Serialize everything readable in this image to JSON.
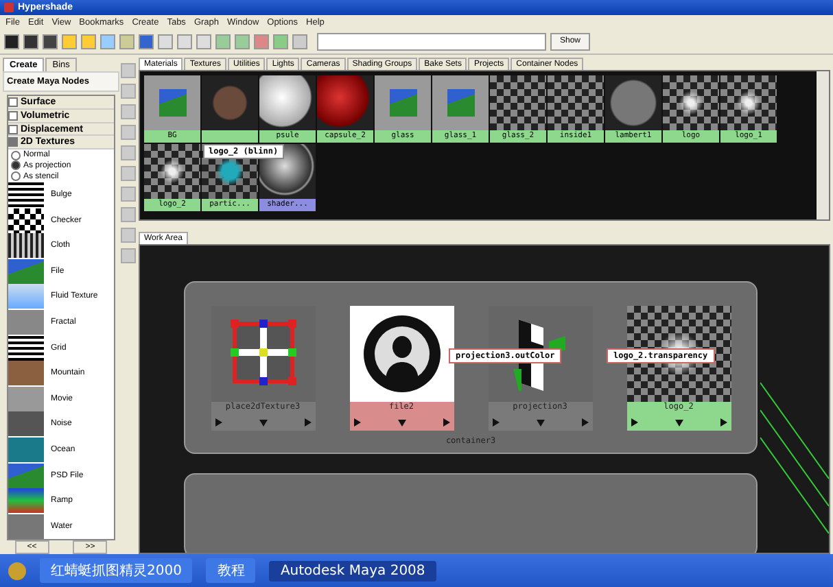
{
  "window": {
    "title": "Hypershade"
  },
  "menu": [
    "File",
    "Edit",
    "View",
    "Bookmarks",
    "Create",
    "Tabs",
    "Graph",
    "Window",
    "Options",
    "Help"
  ],
  "toolbar": {
    "show_button": "Show"
  },
  "left_tabs": [
    {
      "label": "Create",
      "selected": true
    },
    {
      "label": "Bins",
      "selected": false
    }
  ],
  "create_header": "Create Maya Nodes",
  "categories": [
    {
      "label": "Surface",
      "expanded": false
    },
    {
      "label": "Volumetric",
      "expanded": false
    },
    {
      "label": "Displacement",
      "expanded": false
    },
    {
      "label": "2D Textures",
      "expanded": true
    }
  ],
  "modes": [
    {
      "label": "Normal",
      "selected": false
    },
    {
      "label": "As projection",
      "selected": true
    },
    {
      "label": "As stencil",
      "selected": false
    }
  ],
  "textures": [
    {
      "label": "Bulge",
      "kind": "grid"
    },
    {
      "label": "Checker",
      "kind": "checker"
    },
    {
      "label": "Cloth",
      "kind": "cloth"
    },
    {
      "label": "File",
      "kind": "file"
    },
    {
      "label": "Fluid Texture",
      "kind": "fluid"
    },
    {
      "label": "Fractal",
      "kind": "fractal"
    },
    {
      "label": "Grid",
      "kind": "grid"
    },
    {
      "label": "Mountain",
      "kind": "mountain"
    },
    {
      "label": "Movie",
      "kind": "movie"
    },
    {
      "label": "Noise",
      "kind": "noise"
    },
    {
      "label": "Ocean",
      "kind": "ocean"
    },
    {
      "label": "PSD File",
      "kind": "file"
    },
    {
      "label": "Ramp",
      "kind": "ramp"
    },
    {
      "label": "Water",
      "kind": "water"
    }
  ],
  "pager": [
    "<<",
    ">>"
  ],
  "material_tabs": [
    {
      "label": "Materials",
      "selected": true
    },
    {
      "label": "Textures",
      "selected": false
    },
    {
      "label": "Utilities",
      "selected": false
    },
    {
      "label": "Lights",
      "selected": false
    },
    {
      "label": "Cameras",
      "selected": false
    },
    {
      "label": "Shading Groups",
      "selected": false
    },
    {
      "label": "Bake Sets",
      "selected": false
    },
    {
      "label": "Projects",
      "selected": false
    },
    {
      "label": "Container Nodes",
      "selected": false
    }
  ],
  "swatches": [
    {
      "label": "BG",
      "kind": "image",
      "selected": false
    },
    {
      "kind": "dark",
      "selected": false
    },
    {
      "label": "psule",
      "kind": "white",
      "selected": false
    },
    {
      "label": "capsule_2",
      "kind": "red",
      "selected": false
    },
    {
      "label": "glass",
      "kind": "image",
      "selected": false
    },
    {
      "label": "glass_1",
      "kind": "image",
      "selected": false
    },
    {
      "label": "glass_2",
      "kind": "checker",
      "selected": false
    },
    {
      "label": "inside1",
      "kind": "checker",
      "selected": false
    },
    {
      "label": "lambert1",
      "kind": "gray",
      "selected": false
    },
    {
      "label": "logo",
      "kind": "glow",
      "selected": false
    },
    {
      "label": "logo_1",
      "kind": "glow",
      "selected": false
    },
    {
      "label": "logo_2",
      "kind": "glow",
      "selected": false
    },
    {
      "label": "partic...",
      "kind": "cyan",
      "selected": false
    },
    {
      "label": "shader...",
      "kind": "chrome",
      "selected": true
    }
  ],
  "tooltip": "logo_2 (blinn)",
  "work_area_tab": "Work Area",
  "container": {
    "label": "container3",
    "nodes": [
      {
        "label": "place2dTexture3",
        "kind": "place2d",
        "color": "#7a7a7a"
      },
      {
        "label": "file2",
        "kind": "file",
        "color": "#d98c8c"
      },
      {
        "label": "projection3",
        "kind": "projection",
        "color": "#7a7a7a"
      },
      {
        "label": "logo_2",
        "kind": "checker",
        "color": "#8ed88e"
      }
    ],
    "connection": [
      "projection3.outColor",
      "logo_2.transparency"
    ]
  },
  "taskbar": [
    {
      "label": "红蜻蜓抓图精灵2000",
      "selected": false
    },
    {
      "label": "教程",
      "selected": false
    },
    {
      "label": "Autodesk Maya 2008",
      "selected": true
    }
  ]
}
